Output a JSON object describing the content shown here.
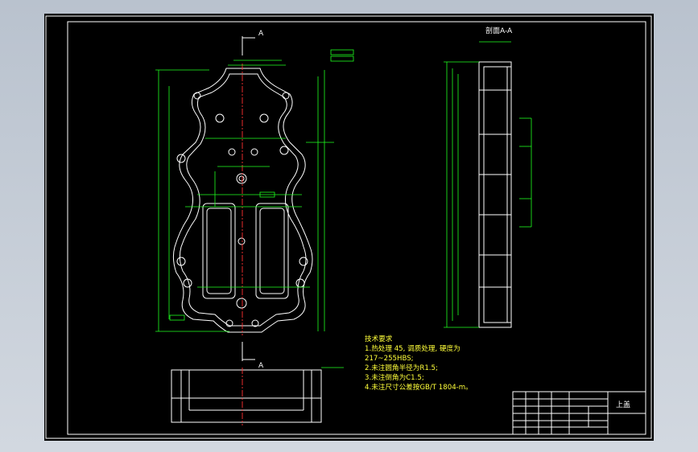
{
  "section_label": "A",
  "section_view_title": "A-A",
  "section_view_prefix": "剖面",
  "tech_requirements": {
    "title": "技术要求",
    "items": [
      "1.热处理 45, 调质处理, 硬度为",
      "217~255HBS;",
      "2.未注圆角半径为R1.5;",
      "3.未注倒角为C1.5;",
      "4.未注尺寸公差按GB/T 1804-m。"
    ]
  },
  "title_block": {
    "part_name": "上盖"
  },
  "colors": {
    "outline": "#ffffff",
    "dimension": "#1fff1f",
    "text": "#ffff3a",
    "centerline": "#ff3030",
    "background": "#000000"
  }
}
